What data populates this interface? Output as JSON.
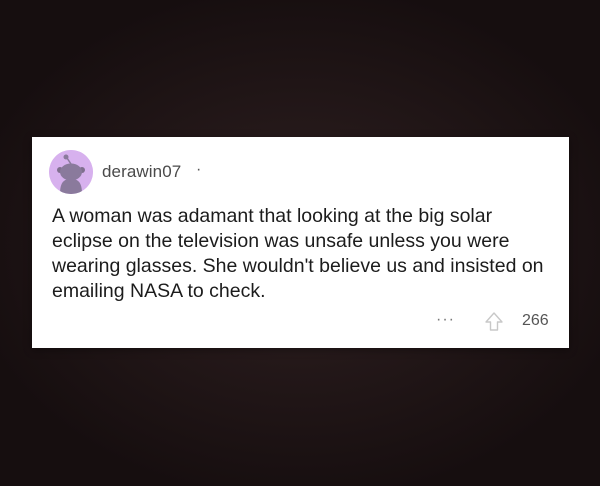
{
  "comment": {
    "username": "derawin07",
    "separator": "·",
    "text": "A woman was adamant that looking at the big solar eclipse on the television was unsafe unless you were wearing glasses. She wouldn't believe us and insisted on emailing NASA to check.",
    "more_label": "···",
    "score": "266",
    "upvote_icon": "arrow-up-icon",
    "avatar_icon": "snoo-avatar-icon",
    "avatar_color": "#d7b1ee"
  }
}
